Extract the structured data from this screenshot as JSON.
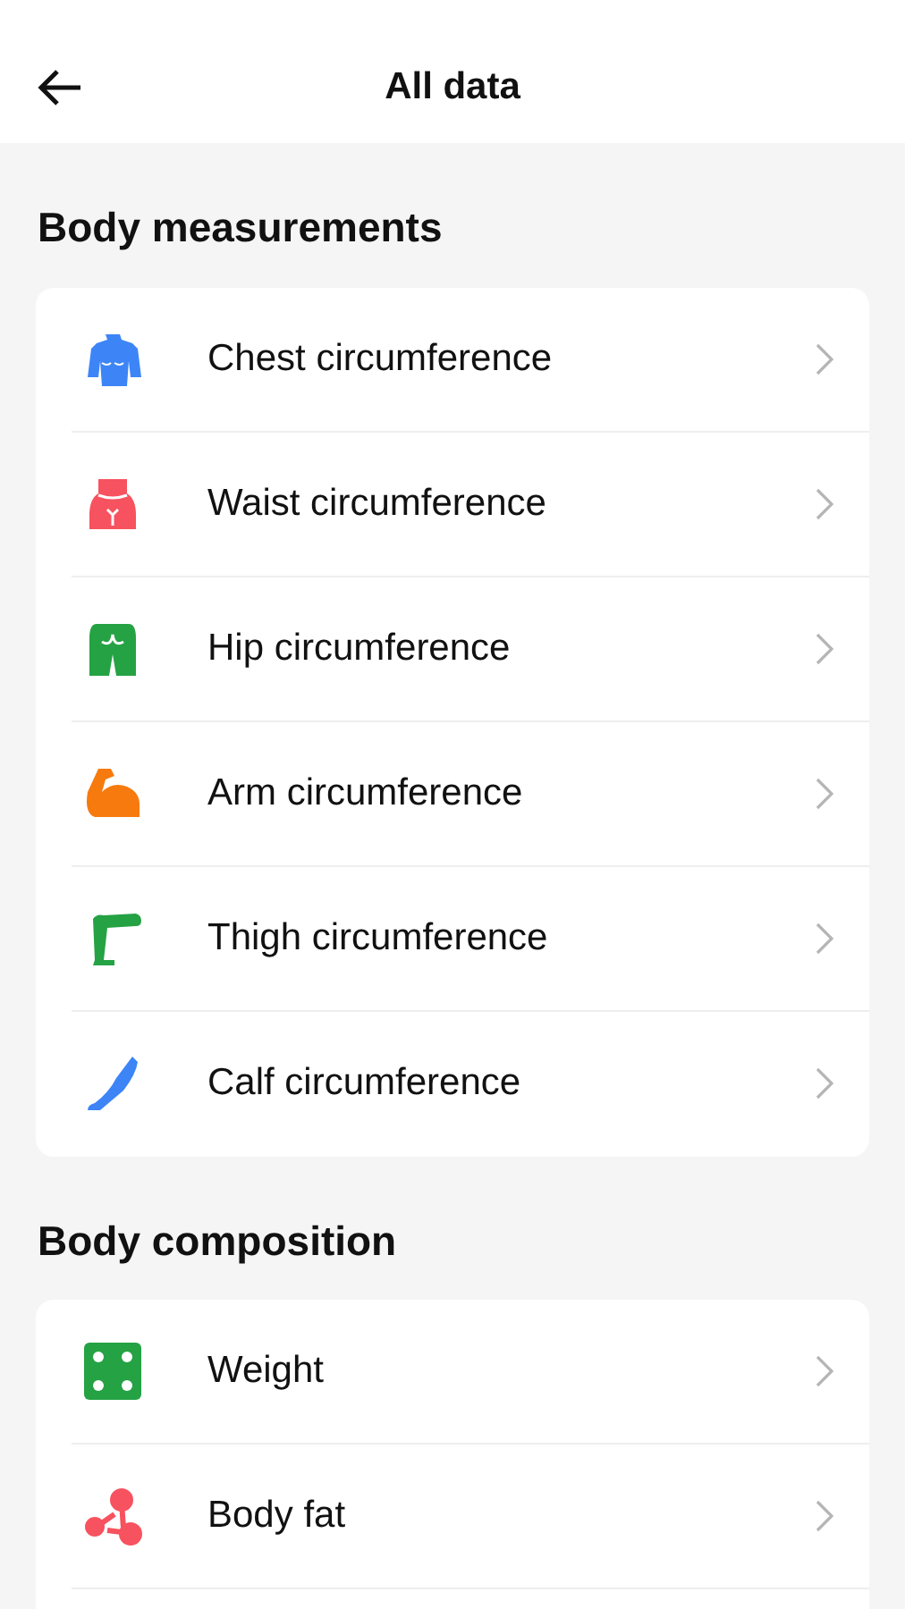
{
  "header": {
    "title": "All data"
  },
  "sections": [
    {
      "title": "Body measurements",
      "items": [
        {
          "label": "Chest circumference",
          "kind": "chest",
          "color": "#3d85f7"
        },
        {
          "label": "Waist circumference",
          "kind": "waist",
          "color": "#f7525f"
        },
        {
          "label": "Hip circumference",
          "kind": "hip",
          "color": "#25a244"
        },
        {
          "label": "Arm circumference",
          "kind": "arm",
          "color": "#f77a0f"
        },
        {
          "label": "Thigh circumference",
          "kind": "thigh",
          "color": "#25a244"
        },
        {
          "label": "Calf circumference",
          "kind": "calf",
          "color": "#3d85f7"
        }
      ]
    },
    {
      "title": "Body composition",
      "items": [
        {
          "label": "Weight",
          "kind": "weight",
          "color": "#25a244"
        },
        {
          "label": "Body fat",
          "kind": "fat",
          "color": "#f7525f"
        }
      ]
    }
  ]
}
